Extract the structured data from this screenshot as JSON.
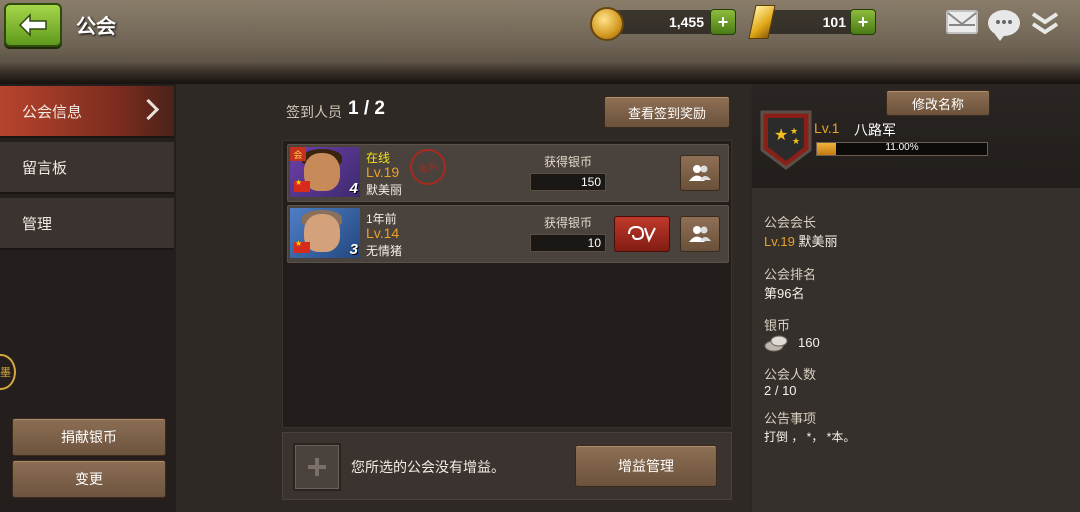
{
  "header": {
    "title": "公会",
    "coins": "1,455",
    "gold": "101"
  },
  "sidebar": {
    "items": [
      {
        "label": "公会信息"
      },
      {
        "label": "留言板"
      },
      {
        "label": "管理"
      }
    ],
    "side_badge": "墨",
    "donate_label": "捐献银币",
    "change_label": "变更"
  },
  "main": {
    "signin_label": "签到人员",
    "signin_count": "1 / 2",
    "rewards_button": "查看签到奖励",
    "members": [
      {
        "status": "在线",
        "level": "Lv.19",
        "name": "默美丽",
        "earn_label": "获得银币",
        "earn_value": "150",
        "avatar_level": "4",
        "stamp": "签到",
        "avatar_tag": "会"
      },
      {
        "status": "1年前",
        "level": "Lv.14",
        "name": "无情猪",
        "earn_label": "获得银币",
        "earn_value": "10",
        "avatar_level": "3"
      }
    ],
    "bonus_text": "您所选的公会没有增益。",
    "bonus_button": "增益管理"
  },
  "guild": {
    "rename_button": "修改名称",
    "level": "Lv.1",
    "name": "八路军",
    "exp_percent": "11.00%",
    "exp_fraction": 0.11,
    "leader_label": "公会会长",
    "leader_level": "Lv.19",
    "leader_name": "默美丽",
    "rank_label": "公会排名",
    "rank_value": "第96名",
    "silver_label": "银币",
    "silver_value": "160",
    "members_label": "公会人数",
    "members_value": "2 / 10",
    "notice_label": "公告事项",
    "notice_value": "打倒 ， *， *本。"
  },
  "colors": {
    "accent_orange": "#e7a22a",
    "active_tab": "#b7442d",
    "online_yellow": "#f3e21c",
    "offline_white": "#f4efe6"
  }
}
